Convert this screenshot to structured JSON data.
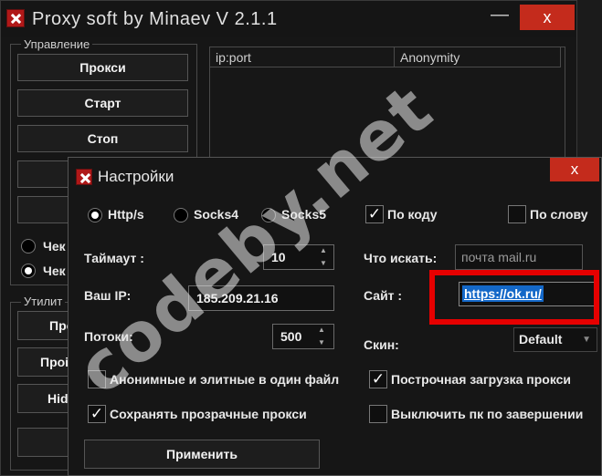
{
  "main_window": {
    "title": "Proxy soft by Minaev V 2.1.1",
    "minimize_label": "—",
    "close_label": "x",
    "control_group_label": "Управление",
    "buttons": {
      "proxies": "Прокси",
      "start": "Старт",
      "stop": "Стоп"
    },
    "radio_labels": [
      "Чек",
      "Чек"
    ],
    "utilities_group_label": "Утилит",
    "utility_buttons": [
      "Про",
      "Проі",
      "Hid"
    ],
    "table_headers": [
      "ip:port",
      "Anonymity"
    ]
  },
  "settings": {
    "title": "Настройки",
    "close_label": "x",
    "protocols": [
      {
        "label": "Http/s",
        "selected": true
      },
      {
        "label": "Socks4",
        "selected": false
      },
      {
        "label": "Socks5",
        "selected": false
      }
    ],
    "by_code": {
      "label": "По коду",
      "checked": true
    },
    "by_word": {
      "label": "По слову",
      "checked": false
    },
    "timeout_label": "Таймаут :",
    "timeout_value": "10",
    "ip_label": "Ваш IP:",
    "ip_value": "185.209.21.16",
    "threads_label": "Потоки:",
    "threads_value": "500",
    "search_label": "Что искать:",
    "search_placeholder": "почта mail.ru",
    "site_label": "Сайт :",
    "site_value": "https://ok.ru/",
    "skin_label": "Скин:",
    "skin_value": "Default",
    "options": {
      "anon_elite_one_file": {
        "label": "Анонимные и элитные в один файл",
        "checked": false
      },
      "save_transparent": {
        "label": "Сохранять прозрачные прокси",
        "checked": true
      },
      "line_by_line_load": {
        "label": "Построчная загрузка прокси",
        "checked": true
      },
      "shutdown_on_finish": {
        "label": "Выключить пк по завершении",
        "checked": false
      }
    },
    "apply_label": "Применить"
  },
  "watermark": "codeby.net",
  "colors": {
    "close_red": "#c42b1c",
    "highlight_red": "#e60000",
    "selection_blue": "#1468c8"
  }
}
